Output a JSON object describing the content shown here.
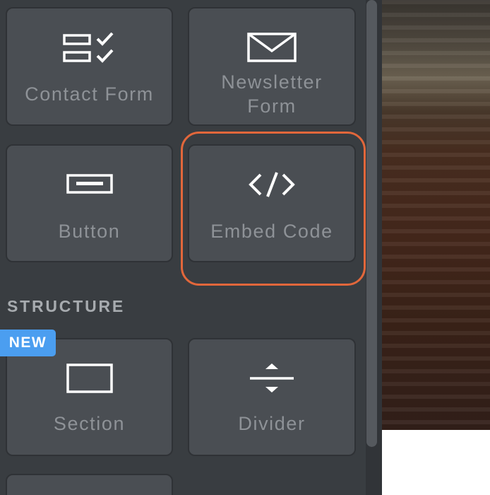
{
  "elements": {
    "contact_form": {
      "label": "Contact Form",
      "icon": "form-checklist-icon"
    },
    "newsletter_form": {
      "label_line1": "Newsletter",
      "label_line2": "Form",
      "icon": "envelope-icon"
    },
    "button": {
      "label": "Button",
      "icon": "button-icon"
    },
    "embed_code": {
      "label": "Embed Code",
      "icon": "code-brackets-icon",
      "highlighted": true
    }
  },
  "structure": {
    "heading": "STRUCTURE",
    "badge": "NEW",
    "section": {
      "label": "Section",
      "icon": "section-rectangle-icon"
    },
    "divider": {
      "label": "Divider",
      "icon": "divider-icon"
    }
  },
  "colors": {
    "panel_bg": "#393d41",
    "tile_bg": "#4a4e53",
    "highlight": "#e2673b",
    "badge_bg": "#4b9ef0"
  }
}
